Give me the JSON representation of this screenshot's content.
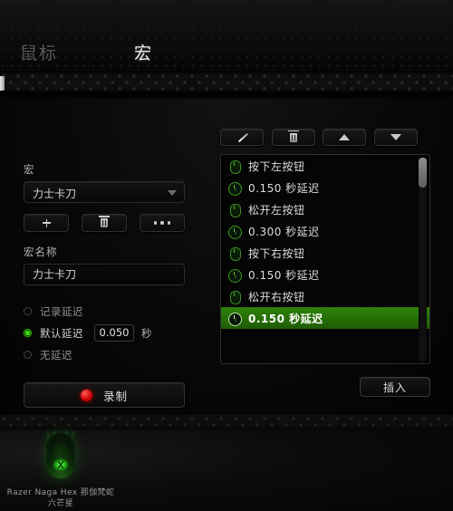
{
  "header": {
    "tabs": [
      {
        "label": "鼠标",
        "active": false
      },
      {
        "label": "宏",
        "active": true
      }
    ]
  },
  "left_panel": {
    "macro_label": "宏",
    "macro_select_value": "力士卡刀",
    "buttons": {
      "add": "add-icon",
      "delete": "trash-icon",
      "more": "more-icon"
    },
    "macro_name_label": "宏名称",
    "macro_name_value": "力士卡刀",
    "delay_options": [
      {
        "label": "记录延迟",
        "selected": false
      },
      {
        "label": "默认延迟",
        "selected": true
      },
      {
        "label": "无延迟",
        "selected": false
      }
    ],
    "delay_value": "0.050",
    "delay_unit": "秒",
    "record_label": "录制"
  },
  "right_panel": {
    "tools": [
      {
        "name": "edit",
        "icon": "pencil-icon"
      },
      {
        "name": "delete",
        "icon": "trash-icon"
      },
      {
        "name": "move-up",
        "icon": "triangle-up-icon"
      },
      {
        "name": "move-down",
        "icon": "triangle-down-icon"
      }
    ],
    "list": [
      {
        "icon": "mouse-icon",
        "text": "按下左按钮",
        "selected": false
      },
      {
        "icon": "clock-icon",
        "text": "0.150 秒延迟",
        "selected": false
      },
      {
        "icon": "mouse-icon",
        "text": "松开左按钮",
        "selected": false
      },
      {
        "icon": "clock-icon",
        "text": "0.300 秒延迟",
        "selected": false
      },
      {
        "icon": "mouse-icon",
        "text": "按下右按钮",
        "selected": false
      },
      {
        "icon": "clock-icon",
        "text": "0.150 秒延迟",
        "selected": false
      },
      {
        "icon": "mouse-icon",
        "text": "松开右按钮",
        "selected": false
      },
      {
        "icon": "clock-icon",
        "text": "0.150 秒延迟",
        "selected": true
      }
    ],
    "insert_label": "插入"
  },
  "footer": {
    "device_name_line1": "Razer Naga Hex 那伽梵蛇",
    "device_name_line2": "六芒星"
  },
  "colors": {
    "accent_green": "#3ddc0d",
    "selection_green": "#2d8209",
    "record_red": "#cc0000",
    "text_primary": "#dcdcdc",
    "text_muted": "#8e8e8e"
  }
}
